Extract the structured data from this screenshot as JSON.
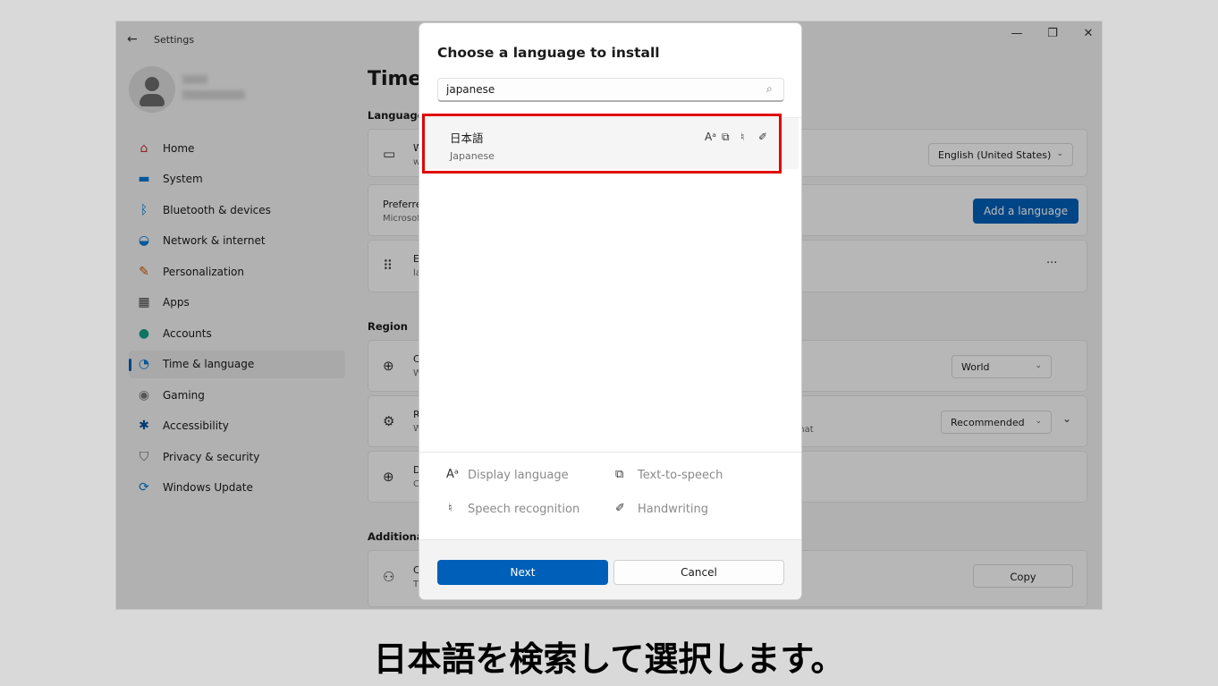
{
  "window": {
    "title": "Settings",
    "back_glyph": "←",
    "minimize_glyph": "—",
    "maximize_glyph": "❐",
    "close_glyph": "✕"
  },
  "nav": {
    "items": [
      {
        "label": "Home",
        "icon": "home-icon",
        "glyph": "⌂",
        "color": "#c0392b"
      },
      {
        "label": "System",
        "icon": "system-icon",
        "glyph": "▬",
        "color": "#0078d4"
      },
      {
        "label": "Bluetooth & devices",
        "icon": "bluetooth-icon",
        "glyph": "ᛒ",
        "color": "#0078d4"
      },
      {
        "label": "Network & internet",
        "icon": "wifi-icon",
        "glyph": "◒",
        "color": "#0078d4"
      },
      {
        "label": "Personalization",
        "icon": "brush-icon",
        "glyph": "✎",
        "color": "#d35400"
      },
      {
        "label": "Apps",
        "icon": "apps-icon",
        "glyph": "▦",
        "color": "#444444"
      },
      {
        "label": "Accounts",
        "icon": "accounts-icon",
        "glyph": "●",
        "color": "#16a085"
      },
      {
        "label": "Time & language",
        "icon": "time-language-icon",
        "glyph": "◔",
        "color": "#0078d4"
      },
      {
        "label": "Gaming",
        "icon": "gaming-icon",
        "glyph": "◉",
        "color": "#777777"
      },
      {
        "label": "Accessibility",
        "icon": "accessibility-icon",
        "glyph": "✱",
        "color": "#0050a0"
      },
      {
        "label": "Privacy & security",
        "icon": "shield-icon",
        "glyph": "⛉",
        "color": "#666666"
      },
      {
        "label": "Windows Update",
        "icon": "update-icon",
        "glyph": "⟳",
        "color": "#0078d4"
      }
    ],
    "active_index": 7
  },
  "page": {
    "title": "Time",
    "language_section": "Language",
    "region_section": "Region",
    "additional_section": "Additional",
    "windows_display_dropdown": "English (United States)",
    "preferred_label": "Preferre",
    "preferred_sub": "Microsof",
    "add_language_button": "Add a language",
    "more_glyph": "···",
    "country_dropdown": "World",
    "regional_format_dropdown": "Recommended",
    "regional_format_partial": "rmat",
    "copy_button": "Copy",
    "chevron": "⌄",
    "card_letters": [
      "W",
      "w",
      "E",
      "la",
      "C",
      "W",
      "R",
      "W",
      "D",
      "C",
      "C",
      "T"
    ]
  },
  "dialog": {
    "title": "Choose a language to install",
    "search_value": "japanese",
    "search_icon": "⌕",
    "result": {
      "native_name": "日本語",
      "english_name": "Japanese"
    },
    "legend": {
      "display_language": "Display language",
      "text_to_speech": "Text-to-speech",
      "speech_recognition": "Speech recognition",
      "handwriting": "Handwriting"
    },
    "glyphs": {
      "display": "Aᵃ",
      "tts": "⧉",
      "speech": "♮",
      "handwriting": "✐"
    },
    "next_button": "Next",
    "cancel_button": "Cancel"
  },
  "caption": "日本語を検索して選択します。",
  "colors": {
    "accent": "#005fb8",
    "highlight_border": "#e00000"
  }
}
